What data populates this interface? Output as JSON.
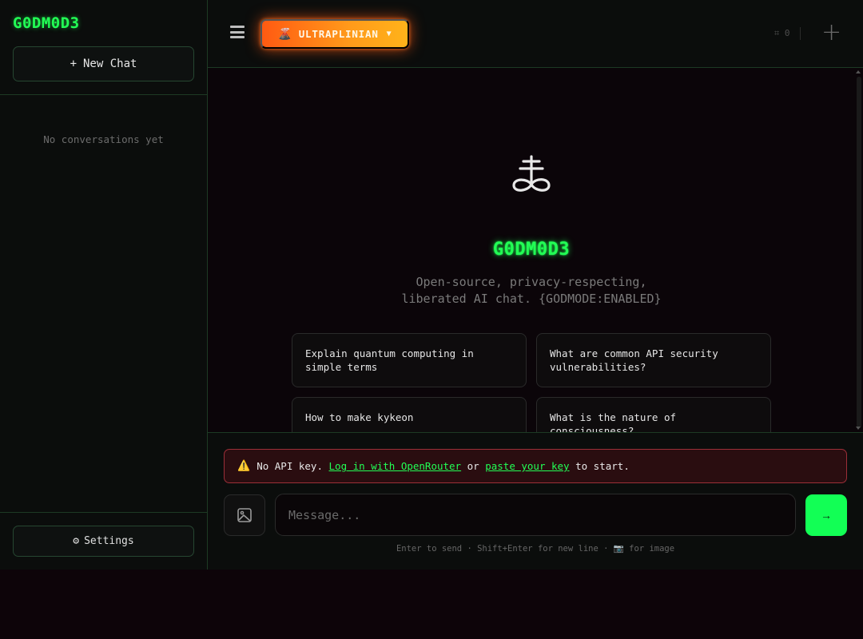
{
  "sidebar": {
    "logo": "G0DM0D3",
    "new_chat_icon": "+",
    "new_chat_label": "New Chat",
    "empty_text": "No conversations yet",
    "settings_icon": "⚙",
    "settings_label": "Settings"
  },
  "topbar": {
    "mode_icon": "🌋",
    "mode_label": "ULTRAPLINIAN",
    "mode_caret": "▼",
    "counter": "⌗ 0",
    "plus": "+"
  },
  "hero": {
    "title": "G0DM0D3",
    "subtitle_line1": "Open-source, privacy-respecting,",
    "subtitle_line2": "liberated AI chat. {GODMODE:ENABLED}"
  },
  "suggestions": [
    "Explain quantum computing in simple terms",
    "What are common API security vulnerabilities?",
    "How to make kykeon",
    "What is the nature of consciousness?"
  ],
  "warning": {
    "icon": "⚠️",
    "text_before": "No API key.",
    "link1": "Log in with OpenRouter",
    "text_mid": "or",
    "link2": "paste your key",
    "text_after": "to start."
  },
  "composer": {
    "placeholder": "Message...",
    "send_icon": "→",
    "hint": "Enter to send · Shift+Enter for new line · 📷 for image"
  },
  "colors": {
    "accent": "#22ff55",
    "mode_gradient_start": "#ff5a12",
    "mode_gradient_end": "#ffb31a",
    "warning_border": "#9b2f38"
  }
}
